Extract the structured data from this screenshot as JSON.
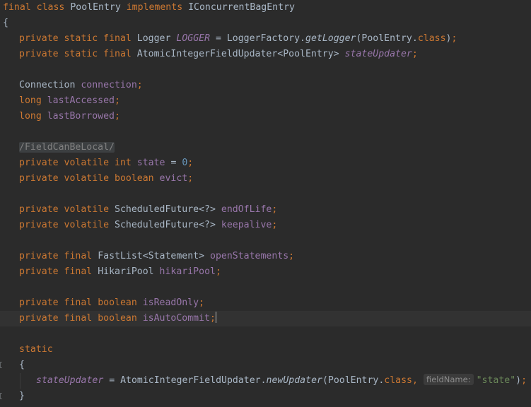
{
  "code": {
    "l1": {
      "kw1": "final",
      "kw2": "class",
      "name": "PoolEntry",
      "kw3": "implements",
      "iface": "IConcurrentBagEntry"
    },
    "l2": {
      "brace": "{"
    },
    "l3": {
      "kw1": "private",
      "kw2": "static",
      "kw3": "final",
      "type": "Logger",
      "field": "LOGGER",
      "eq": " = ",
      "factory": "LoggerFactory.",
      "method": "getLogger",
      "args": "(PoolEntry.",
      "classkw": "class",
      "close": ")",
      "semi": ";"
    },
    "l4": {
      "kw1": "private",
      "kw2": "static",
      "kw3": "final",
      "type": "AtomicIntegerFieldUpdater<PoolEntry>",
      "field": "stateUpdater",
      "semi": ";"
    },
    "l6": {
      "type": "Connection",
      "field": "connection",
      "semi": ";"
    },
    "l7": {
      "kw": "long",
      "field": "lastAccessed",
      "semi": ";"
    },
    "l8": {
      "kw": "long",
      "field": "lastBorrowed",
      "semi": ";"
    },
    "l10": {
      "comment": "/FieldCanBeLocal/"
    },
    "l11": {
      "kw1": "private",
      "kw2": "volatile",
      "kw3": "int",
      "field": "state",
      "eq": " = ",
      "num": "0",
      "semi": ";"
    },
    "l12": {
      "kw1": "private",
      "kw2": "volatile",
      "kw3": "boolean",
      "field": "evict",
      "semi": ";"
    },
    "l14": {
      "kw1": "private",
      "kw2": "volatile",
      "type": "ScheduledFuture<?>",
      "field": "endOfLife",
      "semi": ";"
    },
    "l15": {
      "kw1": "private",
      "kw2": "volatile",
      "type": "ScheduledFuture<?>",
      "field": "keepalive",
      "semi": ";"
    },
    "l17": {
      "kw1": "private",
      "kw2": "final",
      "type": "FastList<Statement>",
      "field": "openStatements",
      "semi": ";"
    },
    "l18": {
      "kw1": "private",
      "kw2": "final",
      "type": "HikariPool",
      "field": "hikariPool",
      "semi": ";"
    },
    "l20": {
      "kw1": "private",
      "kw2": "final",
      "kw3": "boolean",
      "field": "isReadOnly",
      "semi": ";"
    },
    "l21": {
      "kw1": "private",
      "kw2": "final",
      "kw3": "boolean",
      "field": "isAutoCommit",
      "semi": ";"
    },
    "l23": {
      "kw": "static"
    },
    "l24": {
      "brace": "{"
    },
    "l25": {
      "field": "stateUpdater",
      "eq": " = ",
      "cls": "AtomicIntegerFieldUpdater.",
      "method": "newUpdater",
      "args": "(PoolEntry.",
      "classkw": "class",
      "comma": ",",
      "hint": "fieldName:",
      "str": "\"state\"",
      "close": ")",
      "semi": ";"
    },
    "l26": {
      "brace": "}"
    }
  }
}
